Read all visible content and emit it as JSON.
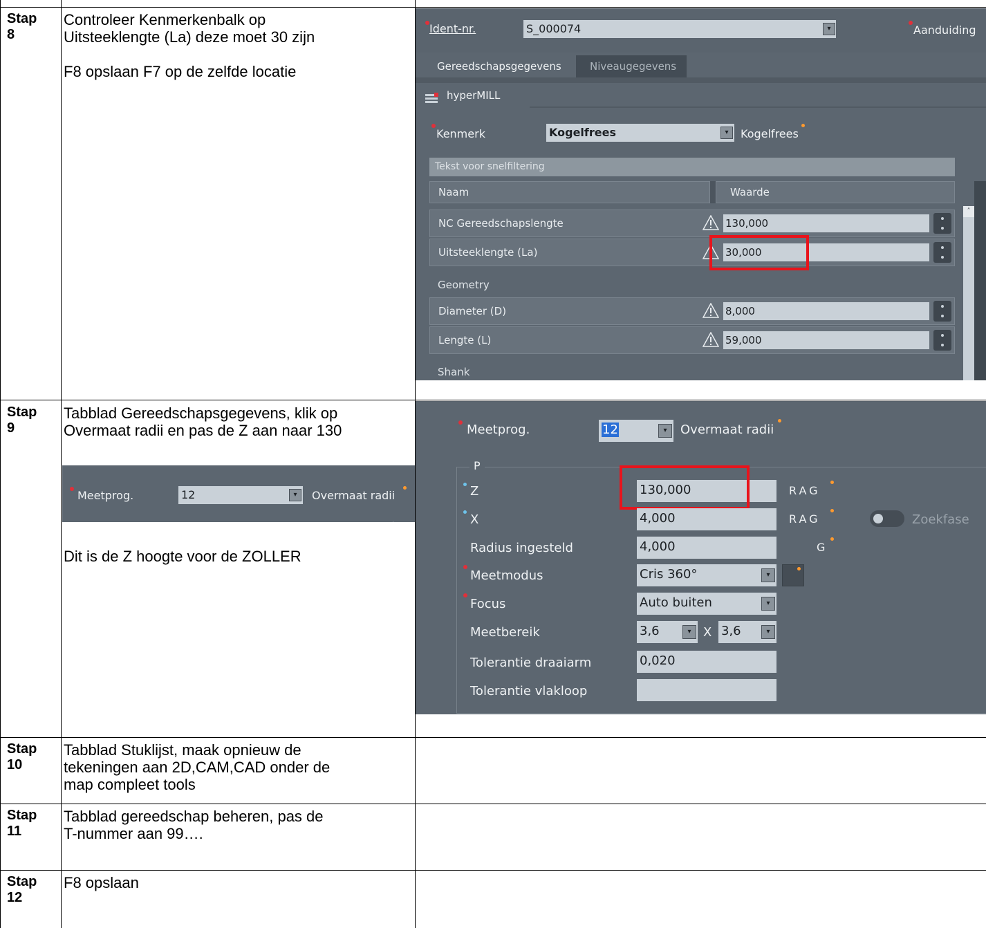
{
  "steps": [
    {
      "label": "Stap 8",
      "desc_lines": [
        "Controleer Kenmerkenbalk op",
        "Uitsteeklengte (La) deze moet 30 zijn"
      ],
      "note": "F8 opslaan  F7 op de zelfde locatie"
    },
    {
      "label": "Stap 9",
      "desc_lines": [
        "Tabblad Gereedschapsgegevens,  klik op",
        "Overmaat radii en pas de Z aan naar 130"
      ],
      "note": "Dit is de Z hoogte voor de ZOLLER"
    },
    {
      "label": "Stap 10",
      "desc_lines": [
        "Tabblad Stuklijst, maak opnieuw de",
        "tekeningen aan 2D,CAM,CAD onder de",
        "map compleet tools"
      ]
    },
    {
      "label": "Stap 11",
      "desc_lines": [
        "Tabblad gereedschap beheren, pas de",
        "T-nummer aan 99…."
      ]
    },
    {
      "label": "Stap 12",
      "desc_lines": [
        "F8 opslaan"
      ]
    }
  ],
  "shot1": {
    "ident_label": "Ident-nr.",
    "ident_value": "S_000074",
    "aanduiding_label": "Aanduiding",
    "tabs": [
      "Gereedschapsgegevens",
      "Niveaugegevens"
    ],
    "subtab": "hyperMILL",
    "kenmerk_label": "Kenmerk",
    "kenmerk_value": "Kogelfrees",
    "kenmerk_text": "Kogelfrees",
    "filter_placeholder": "Tekst voor snelfiltering",
    "col_naam": "Naam",
    "col_waarde": "Waarde",
    "rows": [
      {
        "name": "NC Gereedschapslengte",
        "value": "130,000"
      },
      {
        "name": "Uitsteeklengte (La)",
        "value": "30,000"
      }
    ],
    "section_geometry": "Geometry",
    "geometry_rows": [
      {
        "name": "Diameter (D)",
        "value": "8,000"
      },
      {
        "name": "Lengte (L)",
        "value": "59,000"
      }
    ],
    "section_shank": "Shank"
  },
  "inline": {
    "label": "Meetprog.",
    "value": "12",
    "link": "Overmaat radii"
  },
  "shot2": {
    "meetprog_label": "Meetprog.",
    "meetprog_value": "12",
    "overmaat_label": "Overmaat radii",
    "group_label": "P",
    "z_label": "Z",
    "z_value": "130,000",
    "z_flags": "RAG",
    "x_label": "X",
    "x_value": "4,000",
    "x_flags": "RAG",
    "zoekfase_label": "Zoekfase",
    "radius_label": "Radius ingesteld",
    "radius_value": "4,000",
    "radius_flag": "G",
    "meetmodus_label": "Meetmodus",
    "meetmodus_value": "Cris 360°",
    "focus_label": "Focus",
    "focus_value": "Auto buiten",
    "meetbereik_label": "Meetbereik",
    "meetbereik_a": "3,6",
    "meetbereik_x": "X",
    "meetbereik_b": "3,6",
    "tol_draaiarm_label": "Tolerantie draaiarm",
    "tol_draaiarm_value": "0,020",
    "tol_vlakloop_label": "Tolerantie vlakloop",
    "tol_vlakloop_value": ""
  },
  "colors": {
    "panel": "#5c6670",
    "field": "#c9d1d8",
    "required": "#e0303a",
    "highlight": "#e8141c",
    "orange": "#ff9a2e"
  },
  "icons": [
    "warning-icon",
    "dropdown-arrow-icon",
    "kebab-menu-icon",
    "toggle-switch-icon",
    "hypermill-icon"
  ]
}
